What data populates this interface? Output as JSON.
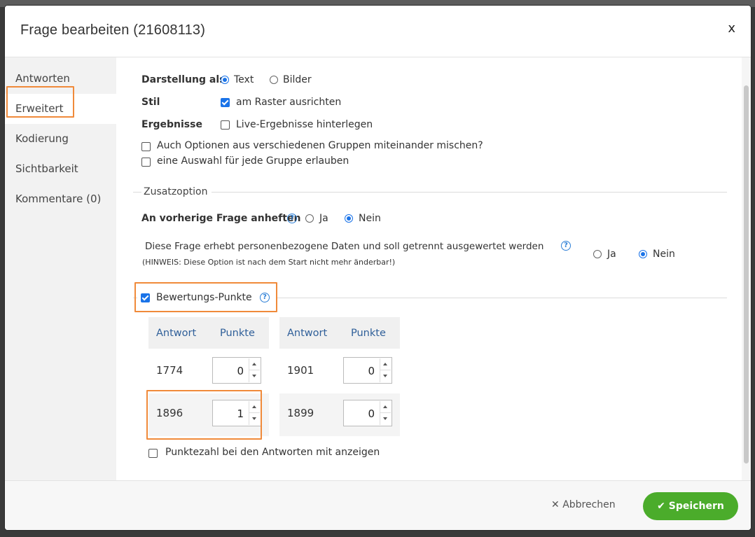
{
  "dialog": {
    "title": "Frage bearbeiten (21608113)",
    "close_label": "x"
  },
  "sidebar": {
    "items": [
      {
        "label": "Antworten"
      },
      {
        "label": "Erweitert"
      },
      {
        "label": "Kodierung"
      },
      {
        "label": "Sichtbarkeit"
      },
      {
        "label": "Kommentare (0)"
      }
    ],
    "active_index": 1
  },
  "form": {
    "darstellung": {
      "label": "Darstellung als",
      "options": [
        "Text",
        "Bilder"
      ],
      "selected": "Text"
    },
    "stil": {
      "label": "Stil",
      "checkbox_label": "am Raster ausrichten",
      "checked": true
    },
    "ergebnisse": {
      "label": "Ergebnisse",
      "checkbox_label": "Live-Ergebnisse hinterlegen",
      "checked": false
    },
    "mix_groups": {
      "label": "Auch Optionen aus verschiedenen Gruppen miteinander mischen?",
      "checked": false
    },
    "one_per_group": {
      "label": "eine Auswahl für jede Gruppe erlauben",
      "checked": false
    },
    "zusatzoption_legend": "Zusatzoption",
    "attach_previous": {
      "label": "An vorherige Frage anheften",
      "options": [
        "Ja",
        "Nein"
      ],
      "selected": "Nein"
    },
    "personal_data": {
      "label": "Diese Frage erhebt personenbezogene Daten und soll getrennt ausgewertet werden",
      "hint": "(HINWEIS: Diese Option ist nach dem Start nicht mehr änderbar!)",
      "options": [
        "Ja",
        "Nein"
      ],
      "selected": "Nein"
    },
    "rating_points": {
      "label": "Bewertungs-Punkte",
      "checked": true,
      "col_answer": "Antwort",
      "col_points": "Punkte",
      "rows_left": [
        {
          "answer": "1774",
          "points": "0"
        },
        {
          "answer": "1896",
          "points": "1"
        }
      ],
      "rows_right": [
        {
          "answer": "1901",
          "points": "0"
        },
        {
          "answer": "1899",
          "points": "0"
        }
      ]
    },
    "show_points": {
      "label": "Punktezahl bei den Antworten mit anzeigen",
      "checked": false
    }
  },
  "footer": {
    "cancel_label": "Abbrechen",
    "save_label": "Speichern"
  },
  "colors": {
    "accent_blue": "#1a73e8",
    "highlight_orange": "#f08a3a",
    "save_green": "#4bac2b",
    "header_blue": "#2f5f99"
  },
  "icons": [
    "close-icon",
    "help-icon",
    "cancel-x-icon",
    "checkmark-icon"
  ]
}
